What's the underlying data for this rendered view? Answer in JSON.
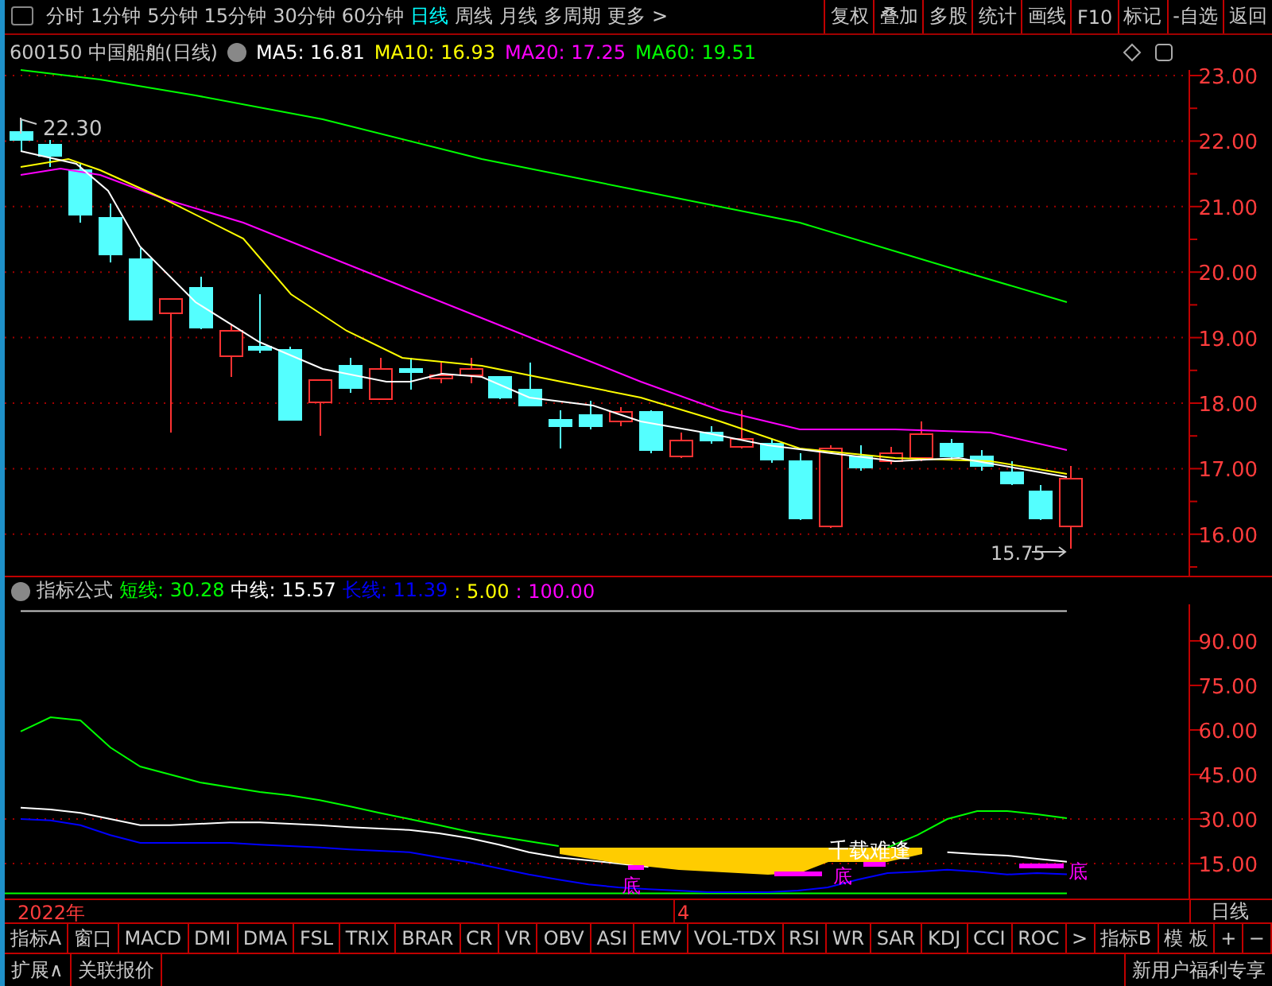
{
  "toolbar": {
    "periods": [
      {
        "label": "分时",
        "selected": false
      },
      {
        "label": "1分钟",
        "selected": false
      },
      {
        "label": "5分钟",
        "selected": false
      },
      {
        "label": "15分钟",
        "selected": false
      },
      {
        "label": "30分钟",
        "selected": false
      },
      {
        "label": "60分钟",
        "selected": false
      },
      {
        "label": "日线",
        "selected": true
      },
      {
        "label": "周线",
        "selected": false
      },
      {
        "label": "月线",
        "selected": false
      },
      {
        "label": "多周期",
        "selected": false
      },
      {
        "label": "更多 >",
        "selected": false
      }
    ],
    "actions": [
      "复权",
      "叠加",
      "多股",
      "统计",
      "画线",
      "F10",
      "标记",
      "-自选",
      "返回"
    ]
  },
  "chart_header": {
    "code": "600150 中国船舶(日线)",
    "averages": [
      {
        "label": "MA5: 16.81",
        "color": "#ffffff"
      },
      {
        "label": "MA10: 16.93",
        "color": "#ffff00"
      },
      {
        "label": "MA20: 17.25",
        "color": "#ff00ff"
      },
      {
        "label": "MA60: 19.51",
        "color": "#00ff00"
      }
    ]
  },
  "price_chart": {
    "axis_labels": [
      "23.00",
      "22.00",
      "21.00",
      "20.00",
      "19.00",
      "18.00",
      "17.00",
      "16.00"
    ],
    "high_label": "22.30",
    "low_label": "15.75"
  },
  "indicator": {
    "title": "指标公式",
    "values": [
      {
        "label": "短线: 30.28",
        "color": "#00ff00"
      },
      {
        "label": "中线: 15.57",
        "color": "#ffffff"
      },
      {
        "label": "长线: 11.39",
        "color": "#0000ff"
      },
      {
        "label": ": 5.00",
        "color": "#ffff00"
      },
      {
        "label": ": 100.00",
        "color": "#ff00ff"
      }
    ],
    "chart_data": {
      "type": "line",
      "ylim": [
        5,
        100
      ],
      "yticks": [
        {
          "value": 90,
          "label": "90.00"
        },
        {
          "value": 75,
          "label": "75.00"
        },
        {
          "value": 60,
          "label": "60.00"
        },
        {
          "value": 45,
          "label": "45.00"
        },
        {
          "value": 30,
          "label": "30.00"
        },
        {
          "value": 15,
          "label": "15.00"
        }
      ],
      "series": [
        {
          "color": "#00ff00",
          "values": [
            59.5,
            64.3,
            63.2,
            54.1,
            47.7,
            45,
            42.3,
            40.7,
            39.1,
            38,
            36.4,
            34.3,
            32.1,
            30,
            27.9,
            25.7,
            24.1,
            22.5,
            20.9,
            null,
            null,
            null,
            null,
            null,
            null,
            null,
            null,
            null,
            null,
            20.4,
            24.6,
            30,
            32.7,
            32.7,
            31.6,
            30.3
          ]
        },
        {
          "color": "#ffffff",
          "values": [
            33.8,
            33.2,
            32.1,
            30,
            27.9,
            27.9,
            28.4,
            28.9,
            28.9,
            28.4,
            27.9,
            27.3,
            26.8,
            26.3,
            25.2,
            23.6,
            21.4,
            18.8,
            17.1,
            16.1,
            15,
            13.9,
            null,
            null,
            null,
            null,
            null,
            null,
            null,
            null,
            null,
            18.8,
            18.2,
            17.7,
            16.6,
            15.6
          ]
        },
        {
          "color": "#0000ff",
          "values": [
            30,
            29.5,
            27.9,
            24.6,
            22,
            22,
            22,
            22,
            21.4,
            20.9,
            20.4,
            19.8,
            19.3,
            18.8,
            17.1,
            15.5,
            13.4,
            11.3,
            9.6,
            8,
            7,
            6.4,
            5.9,
            5.4,
            5.4,
            5.4,
            5.9,
            7,
            9.6,
            11.8,
            12.3,
            12.9,
            12.3,
            11.3,
            11.8,
            11.4
          ]
        }
      ]
    },
    "signal": "千载难逢",
    "bottom_marks": [
      "底",
      "底",
      "底"
    ]
  },
  "date_axis": {
    "labels": [
      "2022年",
      "4"
    ],
    "period": "日线"
  },
  "indicator_tabs": [
    "指标A",
    "窗口",
    "MACD",
    "DMI",
    "DMA",
    "FSL",
    "TRIX",
    "BRAR",
    "CR",
    "VR",
    "OBV",
    "ASI",
    "EMV",
    "VOL-TDX",
    "RSI",
    "WR",
    "SAR",
    "KDJ",
    "CCI",
    "ROC",
    ">",
    "指标B",
    "模 板",
    "+",
    "−"
  ],
  "bottom_bar": {
    "left": [
      "扩展∧",
      "关联报价"
    ],
    "right": "新用户福利专享"
  }
}
